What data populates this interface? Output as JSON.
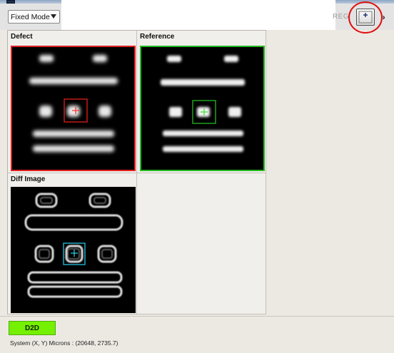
{
  "toolbar": {
    "mode_select": {
      "value": "Fixed Mode"
    },
    "reg_label": "REG",
    "overflow_label": "»",
    "crosshair_button": {
      "icon": "crosshair-icon"
    }
  },
  "panels": [
    {
      "title": "Defect",
      "frame_color": "#e0201e",
      "marker_color": "#ff2a2a"
    },
    {
      "title": "Reference",
      "frame_color": "#27b823",
      "marker_color": "#2ee62a"
    },
    {
      "title": "Diff Image",
      "frame_color": "#000000",
      "marker_color": "#2fd6e6"
    }
  ],
  "footer": {
    "d2d_button": "D2D",
    "status": "System (X, Y) Microns : (20648, 2735.7)"
  },
  "colors": {
    "highlight": "#e01010",
    "d2d": "#74f000"
  }
}
